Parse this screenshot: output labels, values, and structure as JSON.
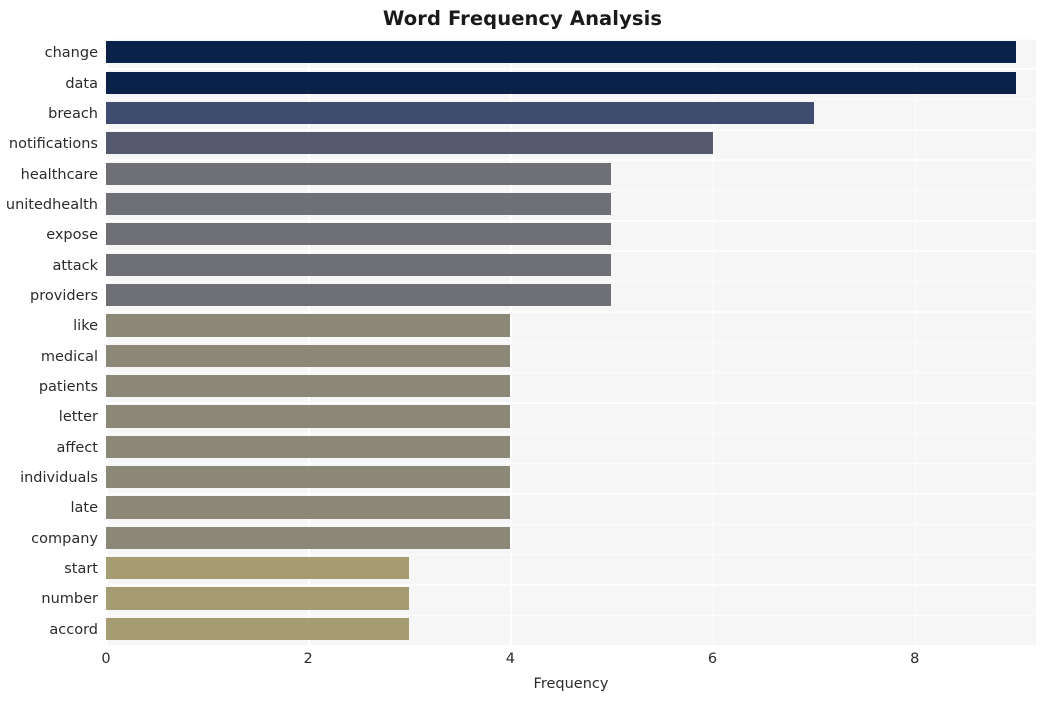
{
  "chart_data": {
    "type": "bar",
    "orientation": "horizontal",
    "title": "Word Frequency Analysis",
    "xlabel": "Frequency",
    "ylabel": "",
    "xlim": [
      0,
      9.2
    ],
    "xticks": [
      0,
      2,
      4,
      6,
      8
    ],
    "xtick_labels": [
      "0",
      "2",
      "4",
      "6",
      "8"
    ],
    "grid": true,
    "legend": "none",
    "categories": [
      "change",
      "data",
      "breach",
      "notifications",
      "healthcare",
      "unitedhealth",
      "expose",
      "attack",
      "providers",
      "like",
      "medical",
      "patients",
      "letter",
      "affect",
      "individuals",
      "late",
      "company",
      "start",
      "number",
      "accord"
    ],
    "values": [
      9,
      9,
      7,
      6,
      5,
      5,
      5,
      5,
      5,
      4,
      4,
      4,
      4,
      4,
      4,
      4,
      4,
      3,
      3,
      3
    ],
    "bar_colors": [
      "#0a2149",
      "#0a2149",
      "#3e4c70",
      "#565a6e",
      "#6e7076",
      "#6e7076",
      "#6e7076",
      "#6e7076",
      "#6e7076",
      "#8c8877",
      "#8c8877",
      "#8c8877",
      "#8c8877",
      "#8c8877",
      "#8c8877",
      "#8c8877",
      "#8c8877",
      "#a69c72",
      "#a69c72",
      "#a69c72"
    ],
    "plot_background": "#f6f6f7",
    "grid_color": "#ffffff",
    "figure_background": "#ffffff",
    "text_color": "#2b2b2b"
  }
}
